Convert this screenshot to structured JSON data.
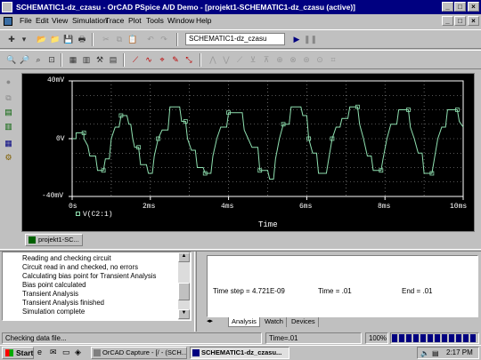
{
  "window": {
    "title": "SCHEMATIC1-dz_czasu - OrCAD PSpice A/D Demo - [projekt1-SCHEMATIC1-dz_czasu (active)]"
  },
  "menu": [
    "File",
    "Edit",
    "View",
    "Simulation",
    "Trace",
    "Plot",
    "Tools",
    "Window",
    "Help"
  ],
  "toolbar": {
    "profile_select": "SCHEMATIC1-dz_czasu"
  },
  "plot": {
    "ytick_top": "40mV",
    "ytick_mid": "0V",
    "ytick_bottom": "-40mV",
    "xticks": [
      "0s",
      "2ms",
      "4ms",
      "6ms",
      "8ms",
      "10ms"
    ],
    "xlabel": "Time",
    "trace_legend": "V(C2:1)",
    "trace_color": "#8fe0b0",
    "grid_color": "#aaaaaa"
  },
  "chart_data": {
    "type": "line",
    "xlabel": "Time",
    "ylabel": "",
    "xlim": [
      0,
      10
    ],
    "ylim": [
      -40,
      40
    ],
    "x_unit": "ms",
    "y_unit": "mV",
    "series": [
      {
        "name": "V(C2:1)",
        "points": [
          [
            0,
            0
          ],
          [
            0.1,
            0
          ],
          [
            0.1,
            4
          ],
          [
            0.3,
            4
          ],
          [
            0.3,
            0
          ],
          [
            0.4,
            -5
          ],
          [
            0.45,
            -12
          ],
          [
            0.6,
            -12
          ],
          [
            0.65,
            -22
          ],
          [
            0.8,
            -22
          ],
          [
            0.85,
            -14
          ],
          [
            0.95,
            -14
          ],
          [
            1.0,
            0
          ],
          [
            1.1,
            8
          ],
          [
            1.2,
            8
          ],
          [
            1.25,
            16
          ],
          [
            1.4,
            16
          ],
          [
            1.45,
            10
          ],
          [
            1.5,
            10
          ],
          [
            1.55,
            0
          ],
          [
            1.6,
            -6
          ],
          [
            1.7,
            -6
          ],
          [
            1.75,
            -18
          ],
          [
            1.9,
            -18
          ],
          [
            1.95,
            -24
          ],
          [
            2.05,
            -24
          ],
          [
            2.1,
            -12
          ],
          [
            2.2,
            0
          ],
          [
            2.3,
            6
          ],
          [
            2.45,
            6
          ],
          [
            2.5,
            22
          ],
          [
            2.75,
            22
          ],
          [
            2.8,
            12
          ],
          [
            2.9,
            12
          ],
          [
            2.95,
            0
          ],
          [
            3.05,
            -8
          ],
          [
            3.15,
            -8
          ],
          [
            3.2,
            -20
          ],
          [
            3.35,
            -20
          ],
          [
            3.4,
            -24
          ],
          [
            3.55,
            -24
          ],
          [
            3.6,
            -12
          ],
          [
            3.7,
            0
          ],
          [
            3.8,
            8
          ],
          [
            3.95,
            8
          ],
          [
            4.0,
            18
          ],
          [
            4.35,
            18
          ],
          [
            4.4,
            6
          ],
          [
            4.5,
            0
          ],
          [
            4.6,
            -6
          ],
          [
            4.75,
            -6
          ],
          [
            4.8,
            -22
          ],
          [
            5.0,
            -22
          ],
          [
            5.05,
            -28
          ],
          [
            5.15,
            -28
          ],
          [
            5.2,
            -14
          ],
          [
            5.3,
            0
          ],
          [
            5.4,
            10
          ],
          [
            5.55,
            10
          ],
          [
            5.6,
            22
          ],
          [
            5.85,
            22
          ],
          [
            5.9,
            16
          ],
          [
            6.0,
            16
          ],
          [
            6.05,
            0
          ],
          [
            6.15,
            -10
          ],
          [
            6.25,
            -10
          ],
          [
            6.3,
            -24
          ],
          [
            6.5,
            -24
          ],
          [
            6.55,
            -16
          ],
          [
            6.65,
            0
          ],
          [
            6.75,
            8
          ],
          [
            6.85,
            8
          ],
          [
            6.9,
            14
          ],
          [
            7.05,
            14
          ],
          [
            7.1,
            22
          ],
          [
            7.3,
            22
          ],
          [
            7.35,
            10
          ],
          [
            7.45,
            0
          ],
          [
            7.55,
            -12
          ],
          [
            7.65,
            -12
          ],
          [
            7.7,
            -22
          ],
          [
            7.9,
            -22
          ],
          [
            7.95,
            -14
          ],
          [
            8.05,
            0
          ],
          [
            8.15,
            10
          ],
          [
            8.3,
            10
          ],
          [
            8.35,
            20
          ],
          [
            8.6,
            20
          ],
          [
            8.65,
            8
          ],
          [
            8.75,
            0
          ],
          [
            8.85,
            -10
          ],
          [
            8.95,
            -10
          ],
          [
            9.0,
            -24
          ],
          [
            9.2,
            -24
          ],
          [
            9.25,
            -16
          ],
          [
            9.35,
            0
          ],
          [
            9.45,
            8
          ],
          [
            9.55,
            8
          ],
          [
            9.6,
            20
          ],
          [
            9.85,
            20
          ],
          [
            9.9,
            12
          ],
          [
            10,
            8
          ]
        ]
      }
    ]
  },
  "project_tab": "projekt1-SC...",
  "output_lines": [
    "Reading and checking circuit",
    "Circuit read in and checked, no errors",
    "Calculating bias point for Transient Analysis",
    "Bias point calculated",
    "Transient Analysis",
    "Transient Analysis finished",
    "Simulation complete"
  ],
  "analysis": {
    "time_step": "Time step =   4.721E-09",
    "time": "Time = .01",
    "end": "End = .01",
    "tabs": [
      "Analysis",
      "Watch",
      "Devices"
    ]
  },
  "status": {
    "message": "Checking data file...",
    "time": "Time=.01",
    "percent": "100%"
  },
  "taskbar": {
    "start": "Start",
    "buttons": [
      "OrCAD Capture - [/ - (SCH...",
      "SCHEMATIC1-dz_czasu..."
    ],
    "clock": "2:17 PM"
  }
}
